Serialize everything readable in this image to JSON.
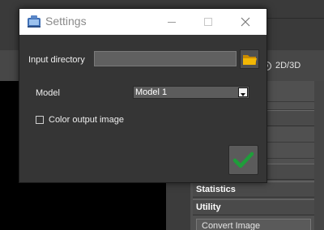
{
  "background": {
    "mode_option": "2D/3D",
    "sections": [
      "ng",
      "tation",
      "Statistics",
      "Utility"
    ],
    "convert_button": "Convert Image"
  },
  "dialog": {
    "title": "Settings",
    "input_directory": {
      "label": "Input directory",
      "value": ""
    },
    "model": {
      "label": "Model",
      "selected": "Model 1"
    },
    "color_output": {
      "label": "Color output image",
      "checked": false
    }
  },
  "icons": {
    "window": "settings-app-icon",
    "browse": "folder-icon",
    "ok": "checkmark-icon",
    "minimize": "minimize-icon",
    "maximize": "maximize-icon",
    "close": "close-icon"
  },
  "colors": {
    "folder": "#f2b705",
    "checkmark": "#1e9e3a",
    "dialog_bg": "#353535"
  }
}
